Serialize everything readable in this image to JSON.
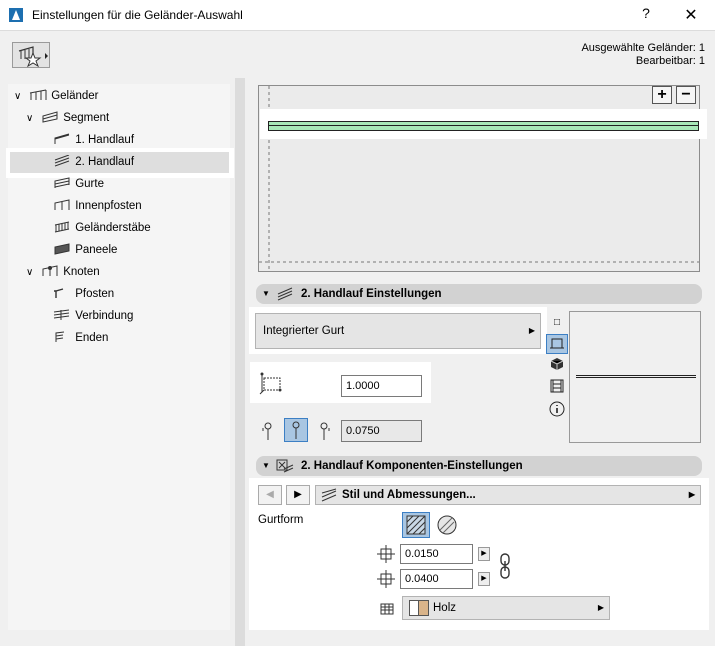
{
  "window": {
    "title": "Einstellungen für die Geländer-Auswahl",
    "help": "?",
    "close": "✕"
  },
  "selection_info": {
    "line1": "Ausgewählte Geländer: 1",
    "line2": "Bearbeitbar: 1"
  },
  "tree": {
    "items": [
      {
        "label": "Geländer",
        "expanded": true
      },
      {
        "label": "Segment",
        "expanded": true
      },
      {
        "label": "1. Handlauf"
      },
      {
        "label": "2. Handlauf",
        "selected": true
      },
      {
        "label": "Gurte"
      },
      {
        "label": "Innenpfosten"
      },
      {
        "label": "Geländerstäbe"
      },
      {
        "label": "Paneele"
      },
      {
        "label": "Knoten",
        "expanded": true
      },
      {
        "label": "Pfosten"
      },
      {
        "label": "Verbindung"
      },
      {
        "label": "Enden"
      }
    ]
  },
  "preview": {
    "zoom_in": "+",
    "zoom_out": "−",
    "line_color": "#a8e8b8"
  },
  "handlauf_settings": {
    "title": "2. Handlauf Einstellungen",
    "type_button": "Integrierter Gurt",
    "scale_value": "1.0000",
    "offset_value": "0.0750"
  },
  "components": {
    "title": "2. Handlauf Komponenten-Einstellungen",
    "style_menu": "Stil und Abmessungen...",
    "gurtform_label": "Gurtform",
    "width_value": "0.0150",
    "height_value": "0.0400",
    "material_label": "Holz",
    "material_color": "#d9b48a"
  },
  "colors": {
    "accent": "#3c7fc4",
    "header_bg": "#d2d2d2"
  }
}
